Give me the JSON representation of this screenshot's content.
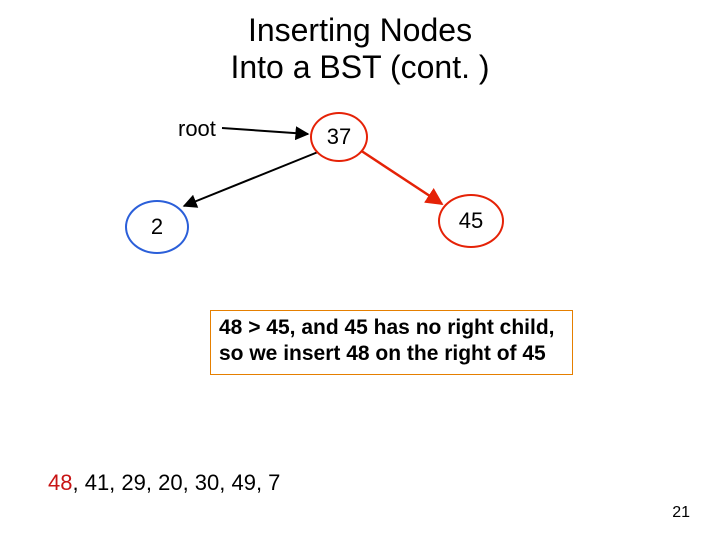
{
  "title_line1": "Inserting Nodes",
  "title_line2": "Into a BST (cont. )",
  "root_label": "root",
  "nodes": {
    "n37": "37",
    "n2": "2",
    "n45": "45"
  },
  "caption": "48 > 45, and 45 has no right child, so we insert 48 on the right of 45",
  "sequence_highlight": "48",
  "sequence_rest": ", 41, 29, 20, 30, 49, 7",
  "page_number": "21",
  "colors": {
    "highlight_red": "#e52207",
    "node_blue": "#2b5fd9",
    "box_orange": "#e57f00",
    "seq_red": "#c81414"
  }
}
